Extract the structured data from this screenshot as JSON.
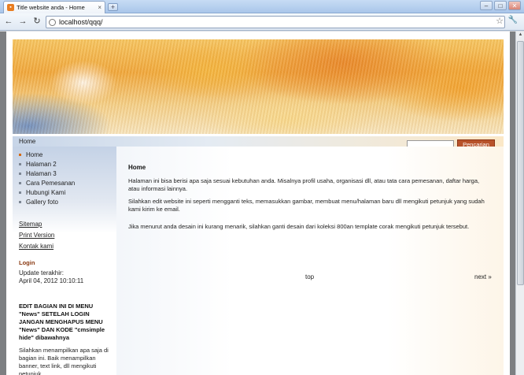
{
  "browser": {
    "tab_title": "Title website anda - Home",
    "tab_close": "×",
    "new_tab": "+",
    "address": "localhost/qqq/",
    "nav": {
      "back": "←",
      "forward": "→",
      "reload": "↻"
    },
    "window_buttons": {
      "minimize": "–",
      "maximize": "□",
      "close": "✕"
    },
    "icons": {
      "star": "☆",
      "wrench": "🔧"
    }
  },
  "site": {
    "breadcrumb": "Home",
    "search": {
      "button": "Pencarian",
      "value": ""
    },
    "menu": [
      "Home",
      "Halaman 2",
      "Halaman 3",
      "Cara Pemesanan",
      "Hubungi Kami",
      "Gallery foto"
    ],
    "links": [
      "Sitemap",
      "Print Version",
      "Kontak kami"
    ],
    "login_label": "Login",
    "update_label": "Update terakhir:",
    "update_date": "April 04, 2012 10:10:11",
    "edit_note": "EDIT BAGIAN INI DI MENU \"News\" SETELAH LOGIN JANGAN MENGHAPUS MENU \"News\" DAN KODE \"cmsimple hide\" dibawahnya",
    "side_paragraph": "Silahkan menampilkan apa saja di bagian ini. Baik menampilkan banner, text link, dll mengikuti petunjuk"
  },
  "main": {
    "title": "Home",
    "paragraphs": [
      "Halaman ini bisa berisi apa saja sesuai kebutuhan anda. Misalnya profil usaha, organisasi dll, atau tata cara pemesanan, daftar harga, atau informasi lainnya.",
      "Silahkan edit website ini seperti mengganti teks, memasukkan gambar, membuat menu/halaman baru dll mengikuti petunjuk yang sudah kami kirim ke email.",
      "Jika menurut anda desain ini kurang menarik, silahkan ganti desain dari koleksi 800an template corak mengikuti petunjuk tersebut."
    ],
    "top_link": "top",
    "next_link": "next »"
  },
  "colors": {
    "accent": "#b8522a",
    "login": "#8a3a12",
    "active_bullet": "#d46b16"
  }
}
